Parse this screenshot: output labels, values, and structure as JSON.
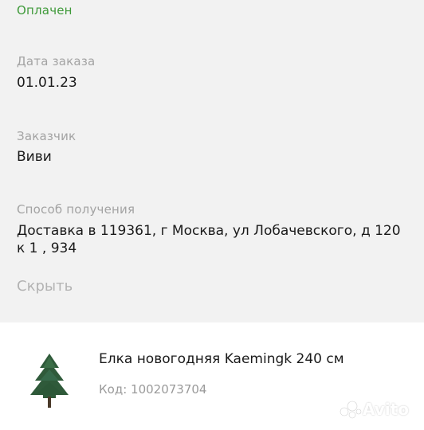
{
  "order": {
    "status": "Оплачен",
    "date_label": "Дата заказа",
    "date_value": "01.01.23",
    "customer_label": "Заказчик",
    "customer_value": "Виви",
    "delivery_label": "Способ получения",
    "delivery_value_line1": "Доставка в 119361, г Москва, ул Лобачевского, д 120",
    "delivery_value_line2": "к 1 , 934",
    "hide_label": "Скрыть"
  },
  "product": {
    "title": "Елка новогодняя Kaemingk 240 см",
    "code": "Код: 1002073704",
    "image_icon": "christmas-tree"
  },
  "watermark": {
    "text": "Avito"
  },
  "colors": {
    "status": "#3f9a3a",
    "label": "#a3a3a3",
    "background": "#f2f2f2"
  }
}
